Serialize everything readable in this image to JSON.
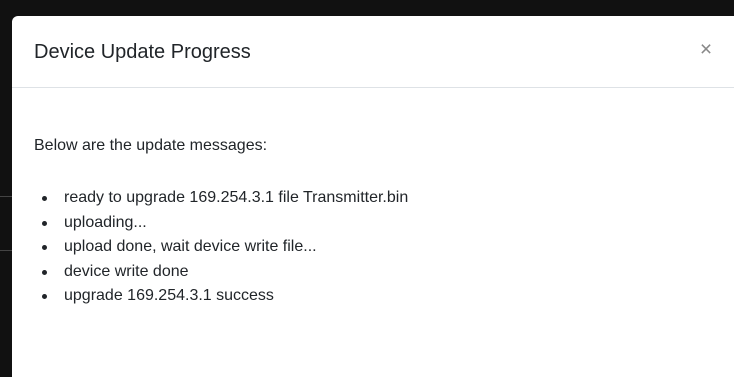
{
  "modal": {
    "title": "Device Update Progress",
    "close_symbol": "×",
    "intro": "Below are the update messages:",
    "messages": [
      "ready to upgrade 169.254.3.1 file Transmitter.bin",
      "uploading...",
      "upload done, wait device write file...",
      "device write done",
      "upgrade 169.254.3.1 success"
    ]
  },
  "icons": {
    "close": "close-icon"
  }
}
